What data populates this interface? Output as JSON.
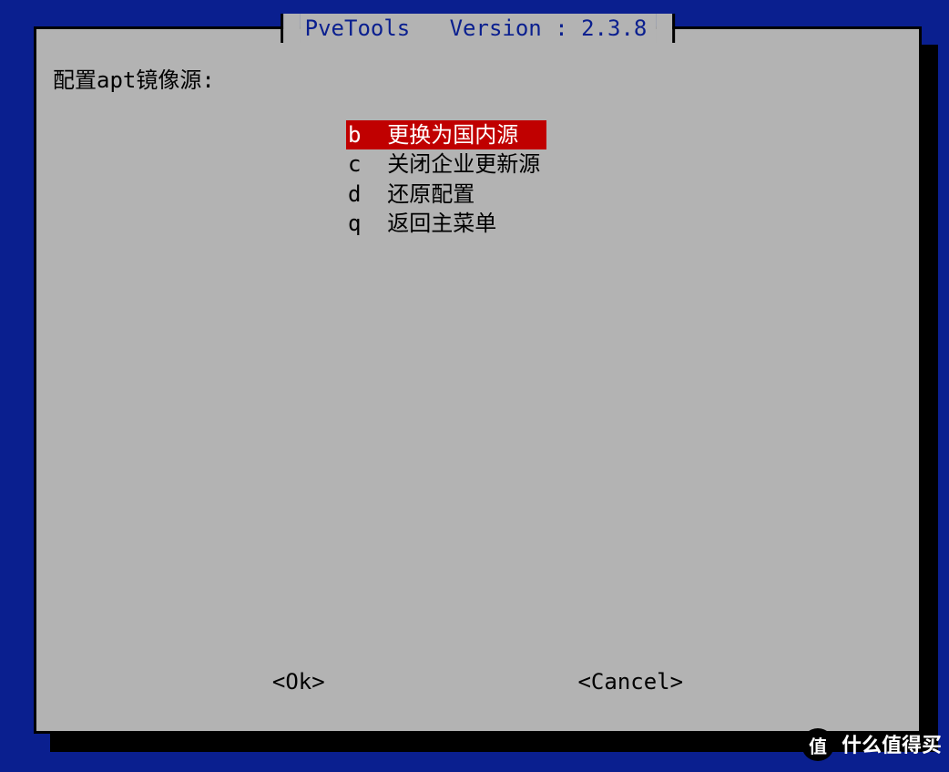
{
  "title": "PveTools   Version : 2.3.8",
  "prompt": "配置apt镜像源:",
  "menu": [
    {
      "key": "b",
      "label": "更换为国内源  ",
      "selected": true
    },
    {
      "key": "c",
      "label": "关闭企业更新源",
      "selected": false
    },
    {
      "key": "d",
      "label": "还原配置",
      "selected": false
    },
    {
      "key": "q",
      "label": "返回主菜单",
      "selected": false
    }
  ],
  "buttons": {
    "ok": "<Ok>",
    "cancel": "<Cancel>"
  },
  "watermark": {
    "badge": "值",
    "text": "什么值得买"
  }
}
